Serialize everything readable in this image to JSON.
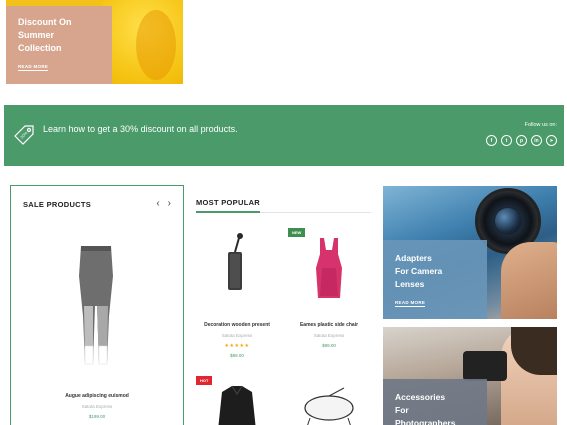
{
  "top_promo": {
    "title": "Discount On\nSummer\nCollection",
    "cta": "READ MORE"
  },
  "banner": {
    "message": "Learn how to get a 30% discount on all products.",
    "follow_label": "Follow us on:",
    "socials": [
      {
        "icon": "facebook-icon",
        "glyph": "f"
      },
      {
        "icon": "twitter-icon",
        "glyph": "t"
      },
      {
        "icon": "pinterest-icon",
        "glyph": "p"
      },
      {
        "icon": "linkedin-icon",
        "glyph": "in"
      },
      {
        "icon": "telegram-icon",
        "glyph": "➤"
      }
    ],
    "background": "#4a9a6a"
  },
  "sale_products": {
    "heading": "SALE PRODUCTS",
    "prev": "‹",
    "next": "›",
    "item": {
      "name": "Augue adipiscing euismod",
      "vendor": "Satota Express",
      "price": "$199.00"
    }
  },
  "most_popular": {
    "heading": "MOST POPULAR",
    "items": [
      {
        "badge": "NEW",
        "name": "Decoration wooden present",
        "vendor": "Satota Express",
        "stars": "★★★★★",
        "price": "$89.00"
      },
      {
        "badge": "",
        "name": "Eames plastic side chair",
        "vendor": "Satota Express",
        "stars": "",
        "price": "$99.00"
      },
      {
        "badge": "HOT",
        "name": "",
        "vendor": "",
        "stars": "",
        "price": ""
      },
      {
        "badge": "",
        "name": "",
        "vendor": "",
        "stars": "",
        "price": ""
      }
    ]
  },
  "right_promos": [
    {
      "title": "Adapters\nFor Camera\nLenses",
      "cta": "READ MORE"
    },
    {
      "title": "Accessories\nFor\nPhotographers",
      "cta": ""
    }
  ],
  "colors": {
    "accent": "#4a9a6a",
    "badge_new": "#3e8f4f",
    "badge_hot": "#e0262e"
  }
}
